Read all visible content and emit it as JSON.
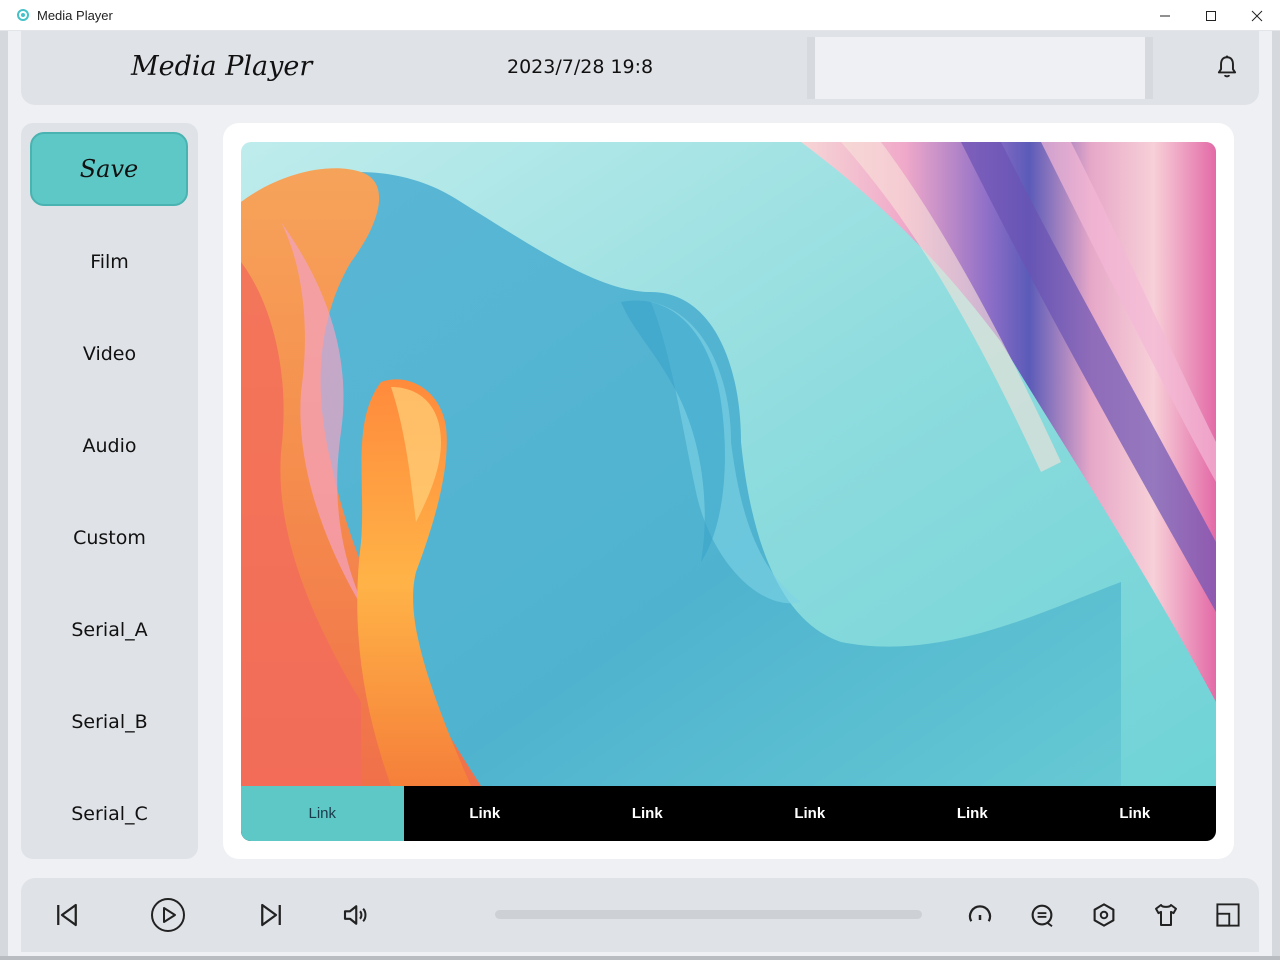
{
  "window": {
    "title": "Media Player",
    "controls": [
      "minimize-icon",
      "maximize-icon",
      "close-icon"
    ]
  },
  "header": {
    "title": "Media Player",
    "datetime": "2023/7/28 19:8",
    "search_value": "",
    "notification_icon": "bell-icon"
  },
  "sidebar": {
    "save_label": "Save",
    "items": [
      {
        "label": "Film"
      },
      {
        "label": "Video"
      },
      {
        "label": "Audio"
      },
      {
        "label": "Custom"
      },
      {
        "label": "Serial_A"
      },
      {
        "label": "Serial_B"
      },
      {
        "label": "Serial_C"
      }
    ]
  },
  "content": {
    "links": [
      {
        "label": "Link",
        "active": true
      },
      {
        "label": "Link",
        "active": false
      },
      {
        "label": "Link",
        "active": false
      },
      {
        "label": "Link",
        "active": false
      },
      {
        "label": "Link",
        "active": false
      },
      {
        "label": "Link",
        "active": false
      }
    ]
  },
  "player": {
    "progress": 0,
    "controls_left": [
      "skip-previous-icon",
      "play-icon",
      "skip-next-icon",
      "volume-icon"
    ],
    "controls_right": [
      "speed-icon",
      "subtitle-icon",
      "settings-icon",
      "skin-icon",
      "fullscreen-icon"
    ]
  },
  "colors": {
    "accent": "#5ec8c6",
    "panel": "#dfe2e7",
    "background": "#eef0f3",
    "link_bar": "#000000"
  }
}
